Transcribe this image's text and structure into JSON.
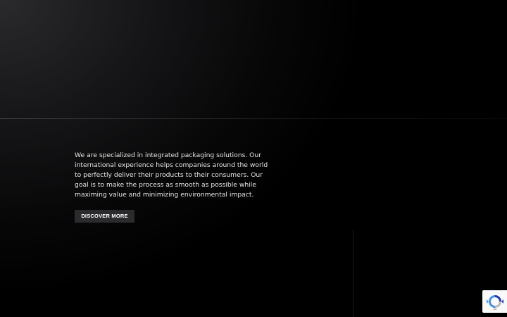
{
  "intro": {
    "text": "We are specialized in integrated packaging solutions. Our international experience helps companies around the world to perfectly deliver their products to their consumers. Our goal is to make the process as smooth as possible while maximing value and minimizing environmental impact."
  },
  "cta": {
    "label": "DISCOVER MORE"
  },
  "recaptcha": {
    "icon": "recaptcha-icon",
    "colors": {
      "blue": "#4a90e2",
      "dark_blue": "#1c3aa9",
      "grey": "#b9b9b9"
    }
  },
  "colors": {
    "background": "#000000",
    "button_bg": "#2b2b2d",
    "text": "#e6e6e6"
  }
}
